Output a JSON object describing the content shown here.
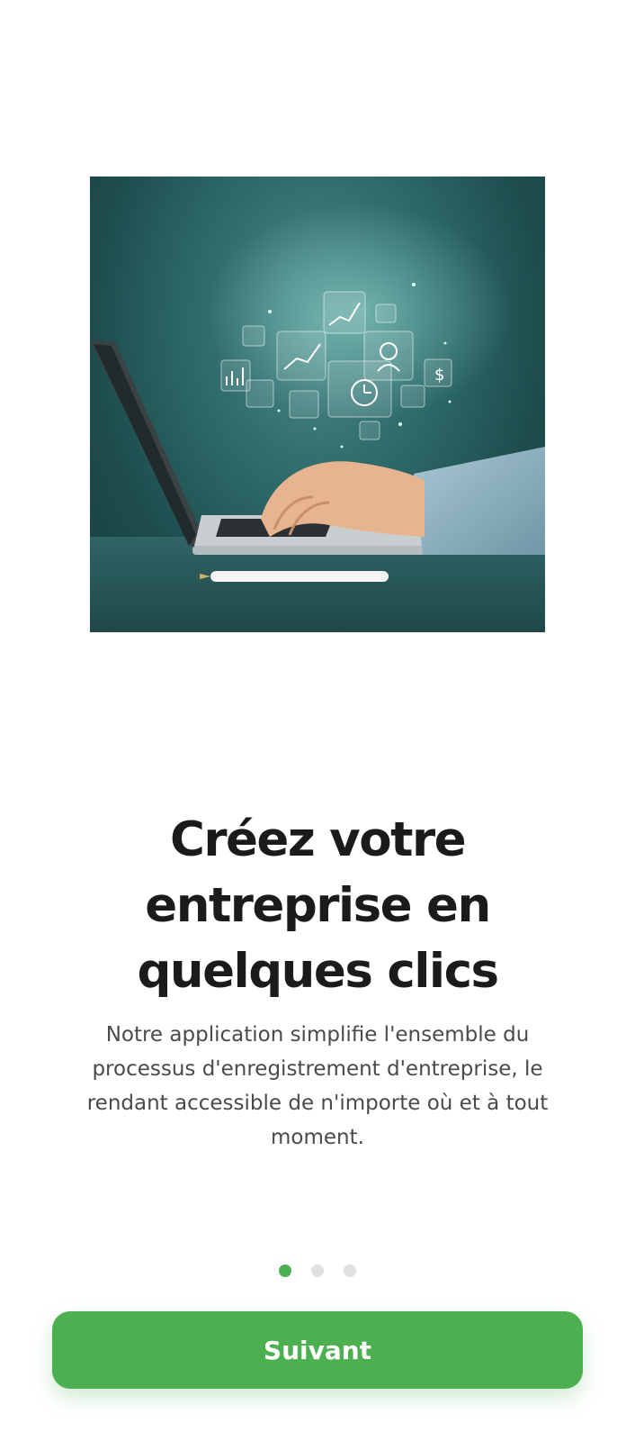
{
  "onboarding": {
    "title": "Créez votre entreprise en quelques clics",
    "description": "Notre application simplifie l'ensemble du processus d'enregistrement d'entreprise, le rendant accessible de n'importe où et à tout moment.",
    "hero_image": "laptop-business-icons-illustration",
    "pagination": {
      "current": 1,
      "total": 3
    },
    "next_button": "Suivant"
  },
  "colors": {
    "accent": "#4caf50",
    "dot_inactive": "#e0e0e0",
    "title": "#1b1b1b",
    "text": "#4a4a4a"
  }
}
